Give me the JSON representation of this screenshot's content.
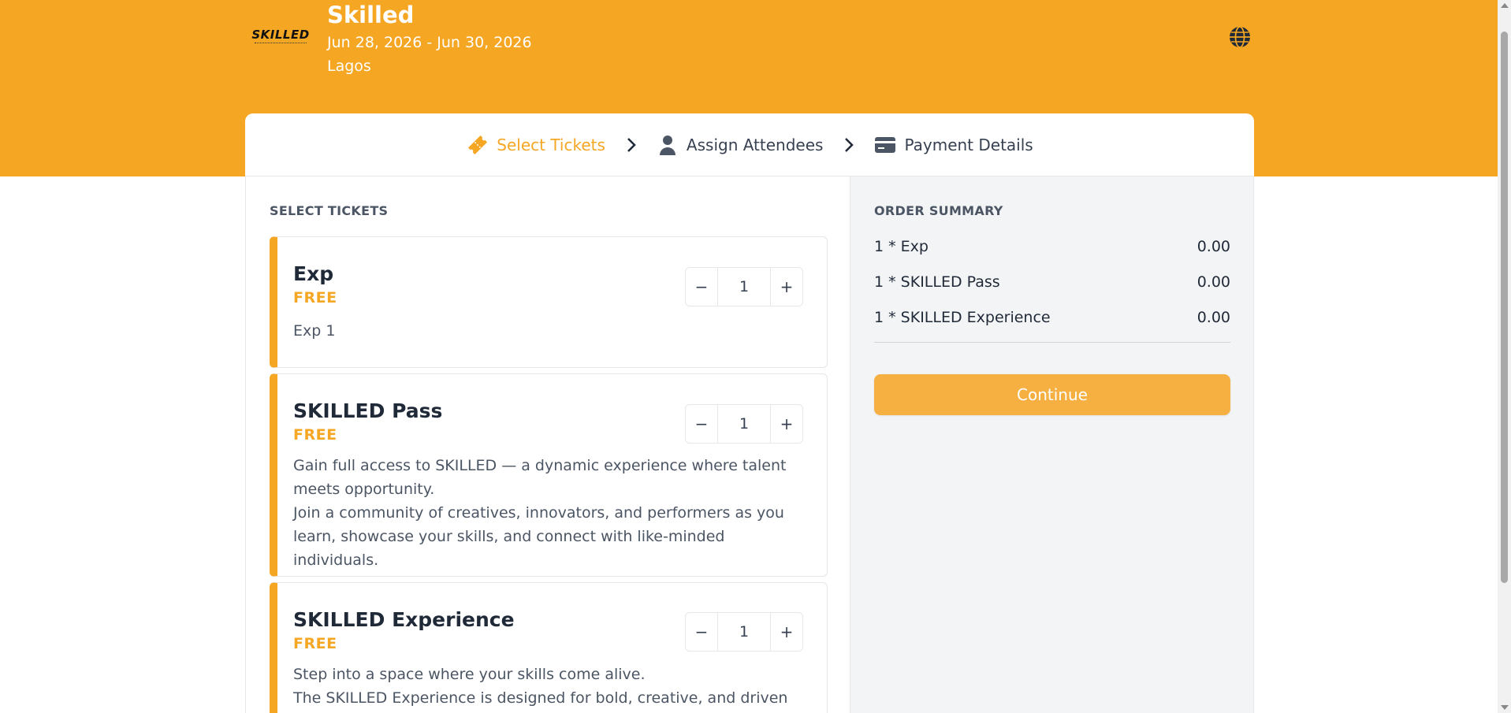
{
  "event": {
    "logo_text": "SKILLED",
    "title": "Skilled",
    "dates": "Jun 28, 2026 - Jun 30, 2026",
    "city": "Lagos"
  },
  "steps": [
    {
      "label": "Select Tickets",
      "icon": "ticket-icon",
      "active": true
    },
    {
      "label": "Assign Attendees",
      "icon": "user-icon",
      "active": false
    },
    {
      "label": "Payment Details",
      "icon": "credit-card-icon",
      "active": false
    }
  ],
  "tickets_section": {
    "heading": "SELECT TICKETS",
    "items": [
      {
        "name": "Exp",
        "price": "FREE",
        "quantity": "1",
        "description": [
          "Exp 1"
        ]
      },
      {
        "name": "SKILLED Pass",
        "price": "FREE",
        "quantity": "1",
        "description": [
          "Gain full access to SKILLED — a dynamic experience where talent",
          "meets opportunity.",
          "Join a community of creatives, innovators, and performers as you",
          "learn, showcase your skills, and connect with like-minded individuals."
        ]
      },
      {
        "name": "SKILLED Experience",
        "price": "FREE",
        "quantity": "1",
        "description": [
          "Step into a space where your skills come alive.",
          "The SKILLED Experience is designed for bold, creative, and driven"
        ]
      }
    ],
    "stepper_minus": "−",
    "stepper_plus": "+"
  },
  "order_summary": {
    "heading": "ORDER SUMMARY",
    "rows": [
      {
        "label": "1 * Exp",
        "amount": "0.00"
      },
      {
        "label": "1 * SKILLED Pass",
        "amount": "0.00"
      },
      {
        "label": "1 * SKILLED Experience",
        "amount": "0.00"
      }
    ],
    "continue_label": "Continue"
  },
  "colors": {
    "accent": "#f5a623",
    "button": "#f5b041",
    "summary_bg": "#f3f4f6"
  }
}
